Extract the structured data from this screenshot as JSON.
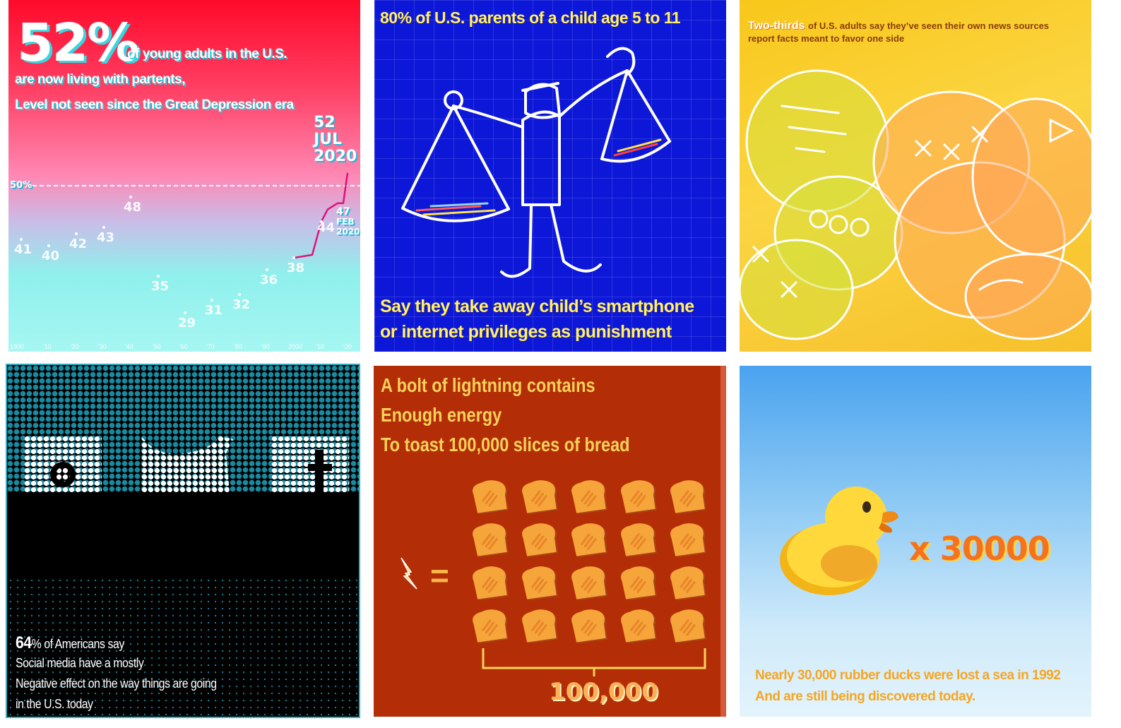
{
  "panel1": {
    "big": "52%",
    "line1": "of young adults in the U.S.",
    "line2": "are now living with partents,",
    "line3": "Level not seen since the Great Depression era",
    "ref_label": "50%",
    "end_value": "52",
    "end_month": "JUL",
    "end_year": "2020",
    "feb_value": "47",
    "feb_month": "FEB",
    "feb_year": "2020",
    "ticks": [
      "1900",
      "'10",
      "'20",
      "'30",
      "'40",
      "'50",
      "'60",
      "'70",
      "'80",
      "'90",
      "2000",
      "'10",
      "'20"
    ]
  },
  "chart_data": {
    "type": "line",
    "x": [
      "1900",
      "1910",
      "1920",
      "1930",
      "1940",
      "1950",
      "1960",
      "1970",
      "1980",
      "1990",
      "2000",
      "2010",
      "Feb 2020",
      "Jul 2020"
    ],
    "values": [
      41,
      40,
      42,
      43,
      48,
      35,
      29,
      31,
      32,
      36,
      38,
      44,
      47,
      52
    ],
    "reference_line": 50,
    "grid": false
  },
  "panel2": {
    "top": "80% of U.S. parents of a child age 5 to 11",
    "bottom1": "Say they take away child’s smartphone",
    "bottom2": "or internet privileges as punishment"
  },
  "panel3": {
    "highlight": "Two-thirds",
    "line1": "of U.S. adults say they’ve seen their own news sources",
    "line2": "report facts meant to favor one side"
  },
  "panel4": {
    "pct": "64",
    "line1_rest": "% of Americans say",
    "line2": "Social media have a mostly",
    "line3": "Negative effect on the way things are going",
    "line4": "in the U.S. today"
  },
  "panel5": {
    "line1": "A bolt of lightning contains",
    "line2": "Enough energy",
    "line3": "To toast 100,000 slices of bread",
    "equals": "=",
    "total": "100,000"
  },
  "panel6": {
    "multiplier": "x 30000",
    "line1": "Nearly 30,000 rubber ducks were lost a sea in 1992",
    "line2": "And are still being discovered today."
  },
  "colors": {
    "p1_shadow": "#39d6e0",
    "p2_bg": "#0d17d8",
    "p2_text": "#fff26a",
    "p3_bg": "#f8c71a",
    "p5_bg": "#b32e07",
    "p5_toast": "#f6a53a",
    "p6_accent": "#f5a623"
  },
  "icons": [
    "balance-scale-figure-illustration",
    "speech-bubbles-illustration",
    "instagram-icon",
    "twitter-icon",
    "facebook-icon",
    "lightning-icon",
    "toast-icon",
    "rubber-duck-icon"
  ]
}
